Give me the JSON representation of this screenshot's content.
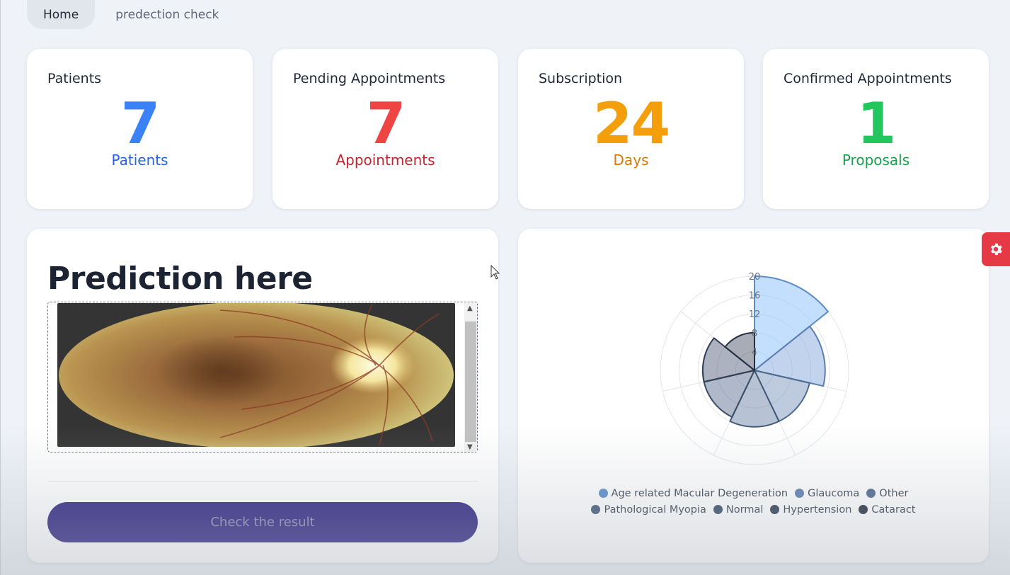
{
  "tabs": [
    {
      "label": "Home"
    },
    {
      "label": "predection check"
    }
  ],
  "stats": [
    {
      "title": "Patients",
      "value": "7",
      "unit": "Patients",
      "value_color": "#3b82f6",
      "unit_color": "#2563eb"
    },
    {
      "title": "Pending Appointments",
      "value": "7",
      "unit": "Appointments",
      "value_color": "#ef4444",
      "unit_color": "#c2262d"
    },
    {
      "title": "Subscription",
      "value": "24",
      "unit": "Days",
      "value_color": "#f59e0b",
      "unit_color": "#d97706"
    },
    {
      "title": "Confirmed Appointments",
      "value": "1",
      "unit": "Proposals",
      "value_color": "#22c55e",
      "unit_color": "#16a34a"
    }
  ],
  "prediction": {
    "title": "Prediction here",
    "button_label": "Check the result"
  },
  "chart_data": {
    "type": "polarArea",
    "r_ticks": [
      4,
      8,
      12,
      16,
      20
    ],
    "r_max": 20,
    "categories": [
      "Age related Macular Degeneration",
      "Glaucoma",
      "Other",
      "Pathological Myopia",
      "Normal",
      "Hypertension",
      "Cataract"
    ],
    "values": [
      20,
      15,
      12,
      12,
      11,
      11,
      8
    ],
    "colors": [
      "#5b8ec9",
      "#5b7fb0",
      "#4e6a90",
      "#435a78",
      "#3b4e66",
      "#2f3e52",
      "#243040"
    ],
    "fill_colors": [
      "rgba(147,197,253,0.55)",
      "rgba(120,160,215,0.45)",
      "rgba(110,140,185,0.45)",
      "rgba(95,120,160,0.45)",
      "rgba(80,100,135,0.45)",
      "rgba(70,85,115,0.45)",
      "rgba(60,70,95,0.45)"
    ],
    "legend_position": "bottom"
  }
}
